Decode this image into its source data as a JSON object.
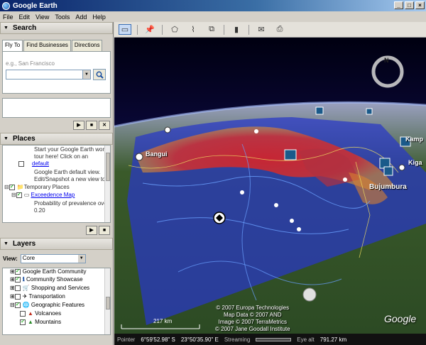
{
  "window": {
    "title": "Google Earth",
    "buttons": [
      "_",
      "□",
      "×"
    ]
  },
  "menu": [
    "File",
    "Edit",
    "View",
    "Tools",
    "Add",
    "Help"
  ],
  "search": {
    "title": "Search",
    "tabs": [
      "Fly To",
      "Find Businesses",
      "Directions"
    ],
    "hint": "e.g., San Francisco",
    "input_value": ""
  },
  "places": {
    "title": "Places",
    "tour_text_1": "Start your Google Earth work",
    "tour_text_2": "tour here! Click on an",
    "default_link": "default",
    "default_text_1": "Google Earth default view.",
    "default_text_2": "Edit/Snapshot a new view to",
    "temporary": "Temporary Places",
    "exceedence": "Exceedence Map",
    "probability_1": "Probability of prevalence over",
    "probability_2": "0.20"
  },
  "layers": {
    "title": "Layers",
    "view_label": "View:",
    "view_value": "Core",
    "items": [
      "Google Earth Community",
      "Community Showcase",
      "Shopping and Services",
      "Transportation",
      "Geographic Features",
      "Volcanoes",
      "Mountains"
    ]
  },
  "map": {
    "labels": {
      "bangui": "Bangui",
      "bujumbura": "Bujumbura",
      "kampala": "Kamp",
      "kigali": "Kiga"
    },
    "copyright": [
      "© 2007 Europa Technologies",
      "Map Data © 2007 AND",
      "Image © 2007 TerraMetrics",
      "© 2007 Jane Goodall Institute"
    ],
    "scale": "217 km",
    "logo": "Google"
  },
  "status": {
    "pointer_label": "Pointer",
    "lat": "6°59'52.98\" S",
    "lon": "23°50'35.90\" E",
    "streaming_label": "Streaming",
    "streaming_progress": 0.0,
    "eye_label": "Eye alt",
    "eye_value": "791.27 km"
  },
  "colors": {
    "heat_high": "#e02020",
    "heat_mid": "#f0c030",
    "heat_low": "#3040c0",
    "ocean": "#0b2a8a"
  }
}
